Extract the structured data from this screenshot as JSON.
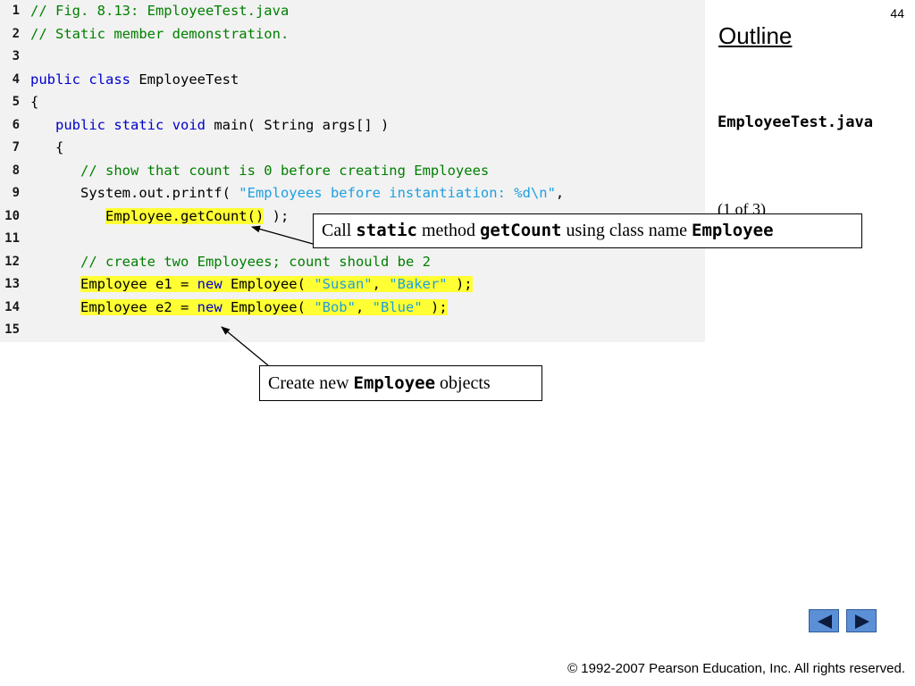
{
  "slide": {
    "page_number": "44",
    "outline_title": "Outline",
    "file_name": "EmployeeTest.java",
    "part_label": "(1 of  3)",
    "copyright": "© 1992-2007 Pearson Education, Inc.  All rights reserved."
  },
  "code": {
    "lines": [
      {
        "num": "1",
        "segments": [
          {
            "t": "// Fig. 8.13: EmployeeTest.java",
            "c": "cm"
          }
        ]
      },
      {
        "num": "2",
        "segments": [
          {
            "t": "// Static member demonstration.",
            "c": "cm"
          }
        ]
      },
      {
        "num": "3",
        "segments": []
      },
      {
        "num": "4",
        "segments": [
          {
            "t": "public",
            "c": "kw"
          },
          {
            "t": " "
          },
          {
            "t": "class",
            "c": "kw"
          },
          {
            "t": " EmployeeTest"
          }
        ]
      },
      {
        "num": "5",
        "segments": [
          {
            "t": "{"
          }
        ]
      },
      {
        "num": "6",
        "segments": [
          {
            "t": "   "
          },
          {
            "t": "public",
            "c": "kw"
          },
          {
            "t": " "
          },
          {
            "t": "static",
            "c": "kw"
          },
          {
            "t": " "
          },
          {
            "t": "void",
            "c": "kw"
          },
          {
            "t": " main( String args[] )"
          }
        ]
      },
      {
        "num": "7",
        "segments": [
          {
            "t": "   {"
          }
        ]
      },
      {
        "num": "8",
        "segments": [
          {
            "t": "      "
          },
          {
            "t": "// show that count is 0 before creating Employees",
            "c": "cm"
          }
        ]
      },
      {
        "num": "9",
        "segments": [
          {
            "t": "      System.out.printf( "
          },
          {
            "t": "\"Employees before instantiation: %d\\n\"",
            "c": "str"
          },
          {
            "t": ","
          }
        ]
      },
      {
        "num": "10",
        "segments": [
          {
            "t": "         "
          },
          {
            "t": "Employee.getCount()",
            "c": "hl"
          },
          {
            "t": " );"
          }
        ]
      },
      {
        "num": "11",
        "segments": []
      },
      {
        "num": "12",
        "segments": [
          {
            "t": "      "
          },
          {
            "t": "// create two Employees; count should be 2",
            "c": "cm"
          }
        ]
      },
      {
        "num": "13",
        "segments": [
          {
            "t": "      "
          },
          {
            "t": "Employee e1 = ",
            "c": "hl"
          },
          {
            "t": "new",
            "c": "kw hl"
          },
          {
            "t": " Employee( ",
            "c": "hl"
          },
          {
            "t": "\"Susan\"",
            "c": "str hl"
          },
          {
            "t": ", ",
            "c": "hl"
          },
          {
            "t": "\"Baker\"",
            "c": "str hl"
          },
          {
            "t": " );",
            "c": "hl"
          }
        ]
      },
      {
        "num": "14",
        "segments": [
          {
            "t": "      "
          },
          {
            "t": "Employee e2 = ",
            "c": "hl"
          },
          {
            "t": "new",
            "c": "kw hl"
          },
          {
            "t": " Employee( ",
            "c": "hl"
          },
          {
            "t": "\"Bob\"",
            "c": "str hl"
          },
          {
            "t": ", ",
            "c": "hl"
          },
          {
            "t": "\"Blue\"",
            "c": "str hl"
          },
          {
            "t": " );",
            "c": "hl"
          }
        ]
      },
      {
        "num": "15",
        "segments": []
      }
    ]
  },
  "callouts": {
    "static_call": {
      "pre": "Call ",
      "kw1": "static",
      "mid": " method ",
      "kw2": "getCount",
      "post": " using class name ",
      "kw3": "Employee"
    },
    "create_objects": {
      "pre": "Create new ",
      "kw": "Employee",
      "post": " objects"
    }
  },
  "nav": {
    "prev_icon": "triangle-left-icon",
    "next_icon": "triangle-right-icon"
  },
  "colors": {
    "keyword": "#0000cc",
    "comment": "#007f00",
    "string": "#1e9fe0",
    "highlight": "#ffff33",
    "code_background": "#f2f2f2",
    "nav_button": "#5b8fd6"
  }
}
